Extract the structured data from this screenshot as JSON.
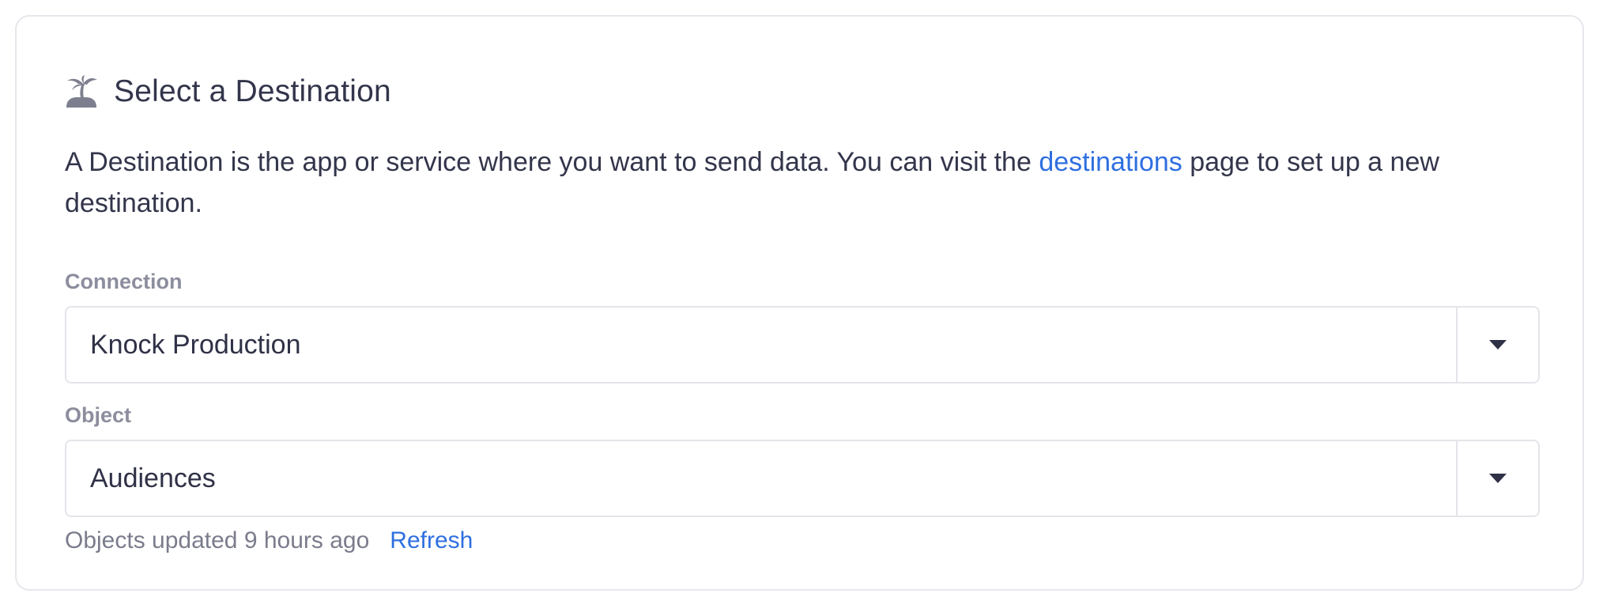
{
  "section": {
    "icon": "palm-tree-island-icon",
    "title": "Select a Destination",
    "description_before": "A Destination is the app or service where you want to send data. You can visit the ",
    "description_link": "destinations",
    "description_after": " page to set up a new destination."
  },
  "connection": {
    "label": "Connection",
    "value": "Knock Production",
    "caret_icon": "caret-down-icon"
  },
  "object": {
    "label": "Object",
    "value": "Audiences",
    "caret_icon": "caret-down-icon"
  },
  "footer": {
    "status": "Objects updated 9 hours ago",
    "refresh_label": "Refresh"
  },
  "colors": {
    "text": "#33354b",
    "link": "#2f6fe0",
    "label": "#8c8e9e",
    "border": "#e4e5ea",
    "icon": "#7d7f8f"
  }
}
